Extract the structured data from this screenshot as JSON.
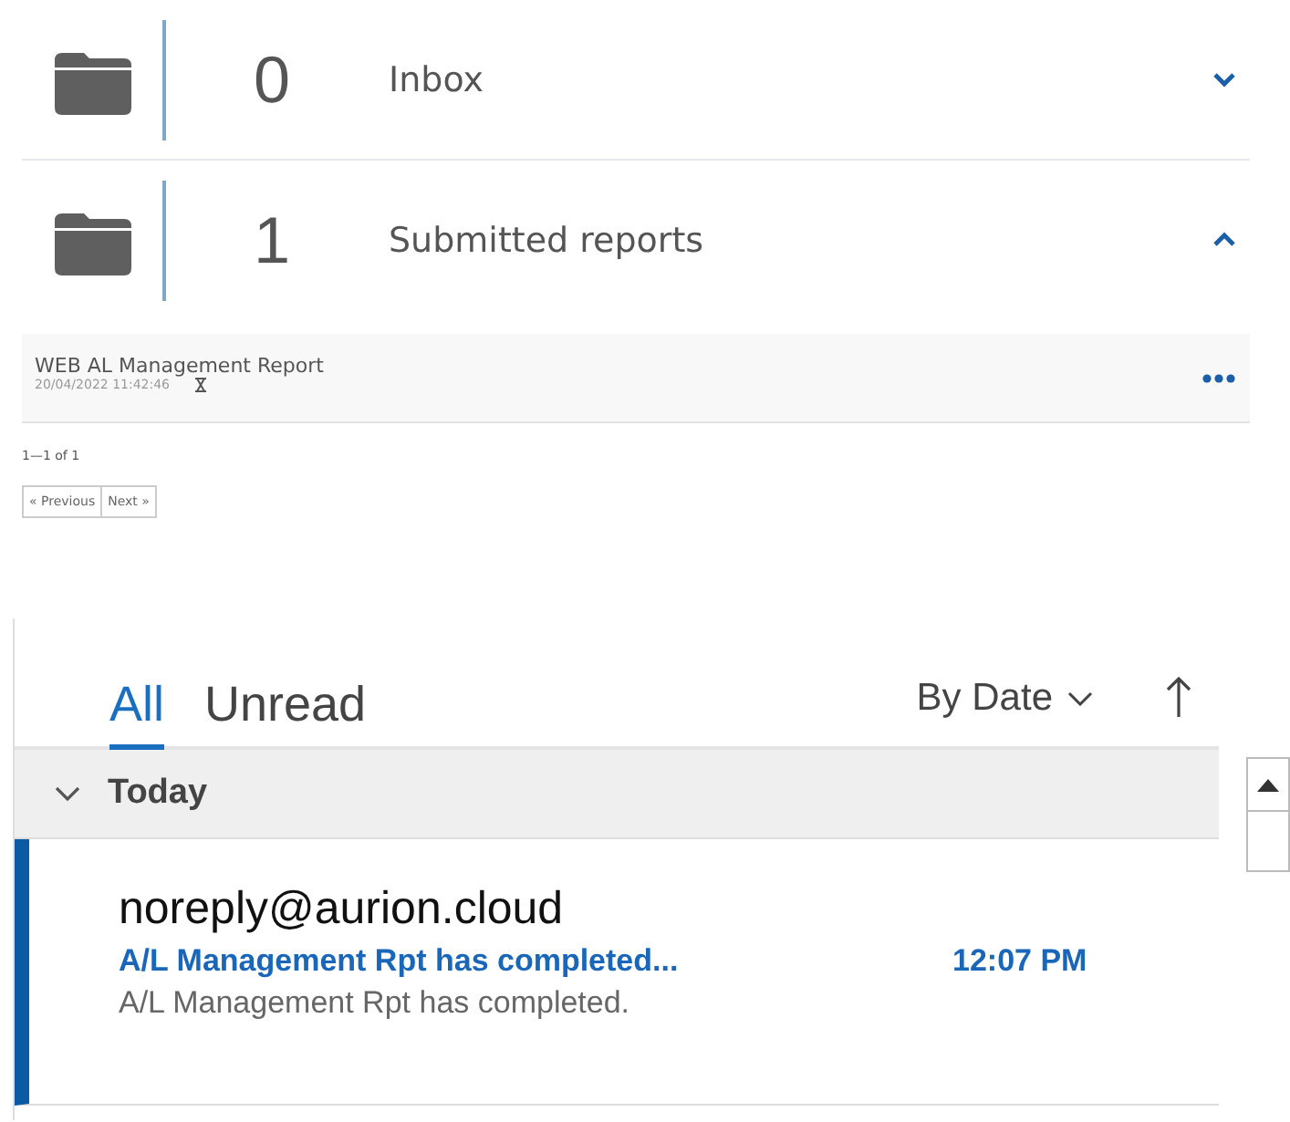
{
  "folders": [
    {
      "count": "0",
      "label": "Inbox",
      "expanded": false
    },
    {
      "count": "1",
      "label": "Submitted reports",
      "expanded": true,
      "reports": [
        {
          "title": "WEB AL Management Report",
          "date": "20/04/2022 11:42:46"
        }
      ],
      "range": "1—1 of 1",
      "pager": [
        "« Previous",
        "Next »"
      ]
    }
  ],
  "mail": {
    "tabs": [
      {
        "label": "All",
        "selected": true
      },
      {
        "label": "Unread",
        "selected": false
      }
    ],
    "sort": "By Date",
    "groups": [
      {
        "label": "Today",
        "expanded": true,
        "messages": [
          {
            "sender": "noreply@aurion.cloud",
            "subject": "A/L Management Rpt has completed...",
            "time": "12:07 PM",
            "preview": "A/L Management Rpt has completed.",
            "selected": true
          }
        ]
      }
    ]
  }
}
